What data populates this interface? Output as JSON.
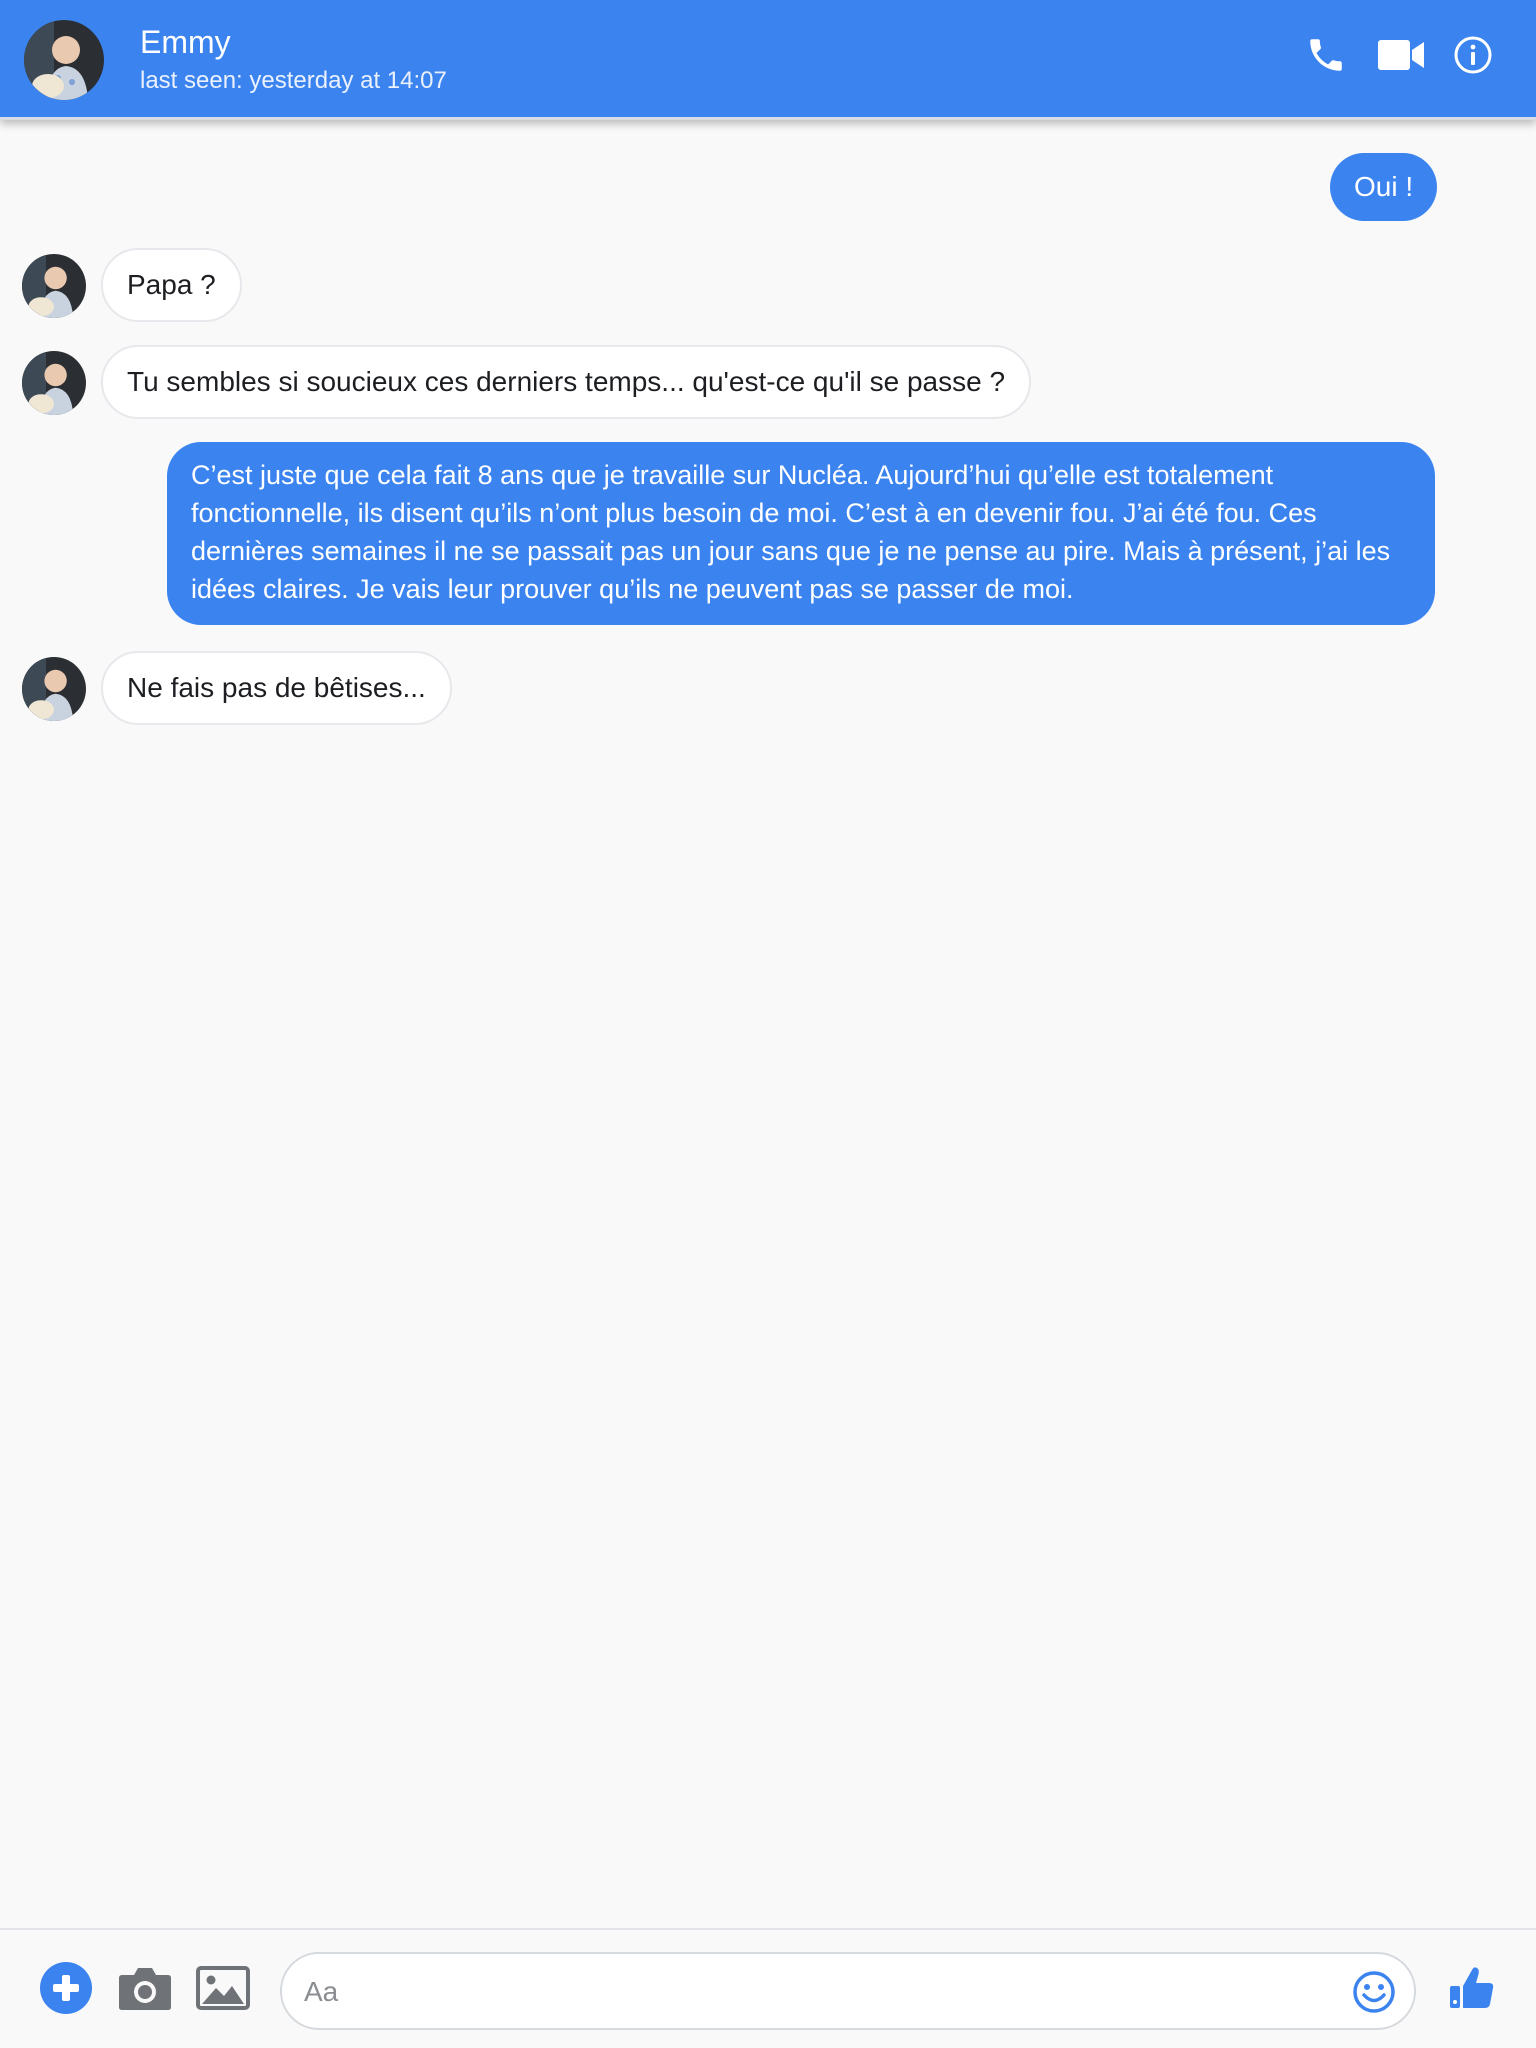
{
  "colors": {
    "accent": "#3b84f0",
    "background": "#f9f9f9",
    "incoming_bubble": "#ffffff",
    "icon_gray": "#6f7378"
  },
  "header": {
    "contact_name": "Emmy",
    "status": "last seen: yesterday at 14:07",
    "icons": [
      "phone-icon",
      "video-camera-icon",
      "info-icon"
    ]
  },
  "messages": [
    {
      "direction": "outgoing",
      "text": "Oui !"
    },
    {
      "direction": "incoming",
      "text": "Papa ?"
    },
    {
      "direction": "incoming",
      "text": "Tu sembles si soucieux ces derniers temps... qu'est-ce qu'il se passe ?"
    },
    {
      "direction": "outgoing",
      "text": "C’est juste que cela fait 8 ans que je travaille sur Nucléa. Aujourd’hui qu’elle est totalement fonctionnelle, ils disent qu’ils n’ont plus besoin de moi. C’est à en devenir fou. J’ai été fou. Ces dernières semaines il ne se passait pas un jour sans que je ne pense au pire. Mais à présent, j’ai les idées claires. Je vais leur prouver qu’ils ne peuvent pas se passer de moi."
    },
    {
      "direction": "incoming",
      "text": "Ne fais pas de bêtises..."
    }
  ],
  "composer": {
    "placeholder": "Aa",
    "value": "",
    "icons": [
      "plus-icon",
      "camera-icon",
      "image-icon",
      "emoji-icon",
      "thumbs-up-icon"
    ]
  }
}
